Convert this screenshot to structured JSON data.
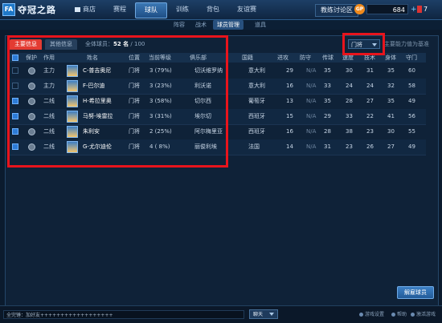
{
  "app": {
    "title": "夺冠之路",
    "logo_text": "FA"
  },
  "nav": {
    "items": [
      "商店",
      "赛程",
      "球队",
      "训练",
      "背包",
      "友谊赛"
    ],
    "active": "球队"
  },
  "header": {
    "forum_label": "教练讨论区",
    "gp_label": "GP",
    "gp_value": "684",
    "plus": "+",
    "messages": "7"
  },
  "subnav": {
    "items": [
      "阵容",
      "战术",
      "球员管理",
      "道具"
    ],
    "active": "球员管理"
  },
  "tabs": {
    "main": "主要信息",
    "other": "其他信息"
  },
  "summary": {
    "label": "全体球员：",
    "count": "52 名",
    "total": "/ 100"
  },
  "filter": {
    "selected": "门将",
    "sort_label": "主要能力值为基准"
  },
  "table": {
    "headers": [
      "保护",
      "作用",
      "姓名",
      "位置",
      "当前等级",
      "俱乐部",
      "国籍",
      "进攻",
      "防守",
      "传球",
      "速度",
      "技术",
      "身体",
      "守门"
    ],
    "rows": [
      {
        "checked": false,
        "role": "主力",
        "name": "C-普吉奥尼",
        "pos": "门将",
        "level": "3 (79%)",
        "club": "切沃维罗纳",
        "nation": "意大利",
        "att": "29",
        "def": "N/A",
        "pass": "35",
        "spd": "30",
        "tech": "31",
        "body": "35",
        "gk": "60"
      },
      {
        "checked": false,
        "role": "主力",
        "name": "F-巴尔迪",
        "pos": "门将",
        "level": "3 (23%)",
        "club": "利沃诺",
        "nation": "意大利",
        "att": "16",
        "def": "N/A",
        "pass": "33",
        "spd": "24",
        "tech": "24",
        "body": "32",
        "gk": "58"
      },
      {
        "checked": true,
        "role": "二线",
        "name": "H-希拉里奥",
        "pos": "门将",
        "level": "3 (58%)",
        "club": "切尔西",
        "nation": "葡萄牙",
        "att": "13",
        "def": "N/A",
        "pass": "35",
        "spd": "28",
        "tech": "27",
        "body": "35",
        "gk": "49"
      },
      {
        "checked": true,
        "role": "二线",
        "name": "马努-埃雷拉",
        "pos": "门将",
        "level": "3 (31%)",
        "club": "埃尔切",
        "nation": "西班牙",
        "att": "15",
        "def": "N/A",
        "pass": "29",
        "spd": "33",
        "tech": "22",
        "body": "41",
        "gk": "56"
      },
      {
        "checked": true,
        "role": "二线",
        "name": "朱利安",
        "pos": "门将",
        "level": "2 (25%)",
        "club": "阿尔梅里亚",
        "nation": "西班牙",
        "att": "16",
        "def": "N/A",
        "pass": "28",
        "spd": "38",
        "tech": "23",
        "body": "30",
        "gk": "55"
      },
      {
        "checked": true,
        "role": "二线",
        "name": "G-尤尔迪伦",
        "pos": "门将",
        "level": "4 ( 8%)",
        "club": "丽俊利埃",
        "nation": "法国",
        "att": "14",
        "def": "N/A",
        "pass": "31",
        "spd": "23",
        "tech": "26",
        "body": "27",
        "gk": "49"
      }
    ]
  },
  "actions": {
    "release": "解雇球员"
  },
  "footer": {
    "chat_text": "全完锤：加好友++++++++++++++++++",
    "chat_channel": "聊天",
    "links": [
      "游戏设置",
      "帮助",
      "激活游戏"
    ]
  }
}
